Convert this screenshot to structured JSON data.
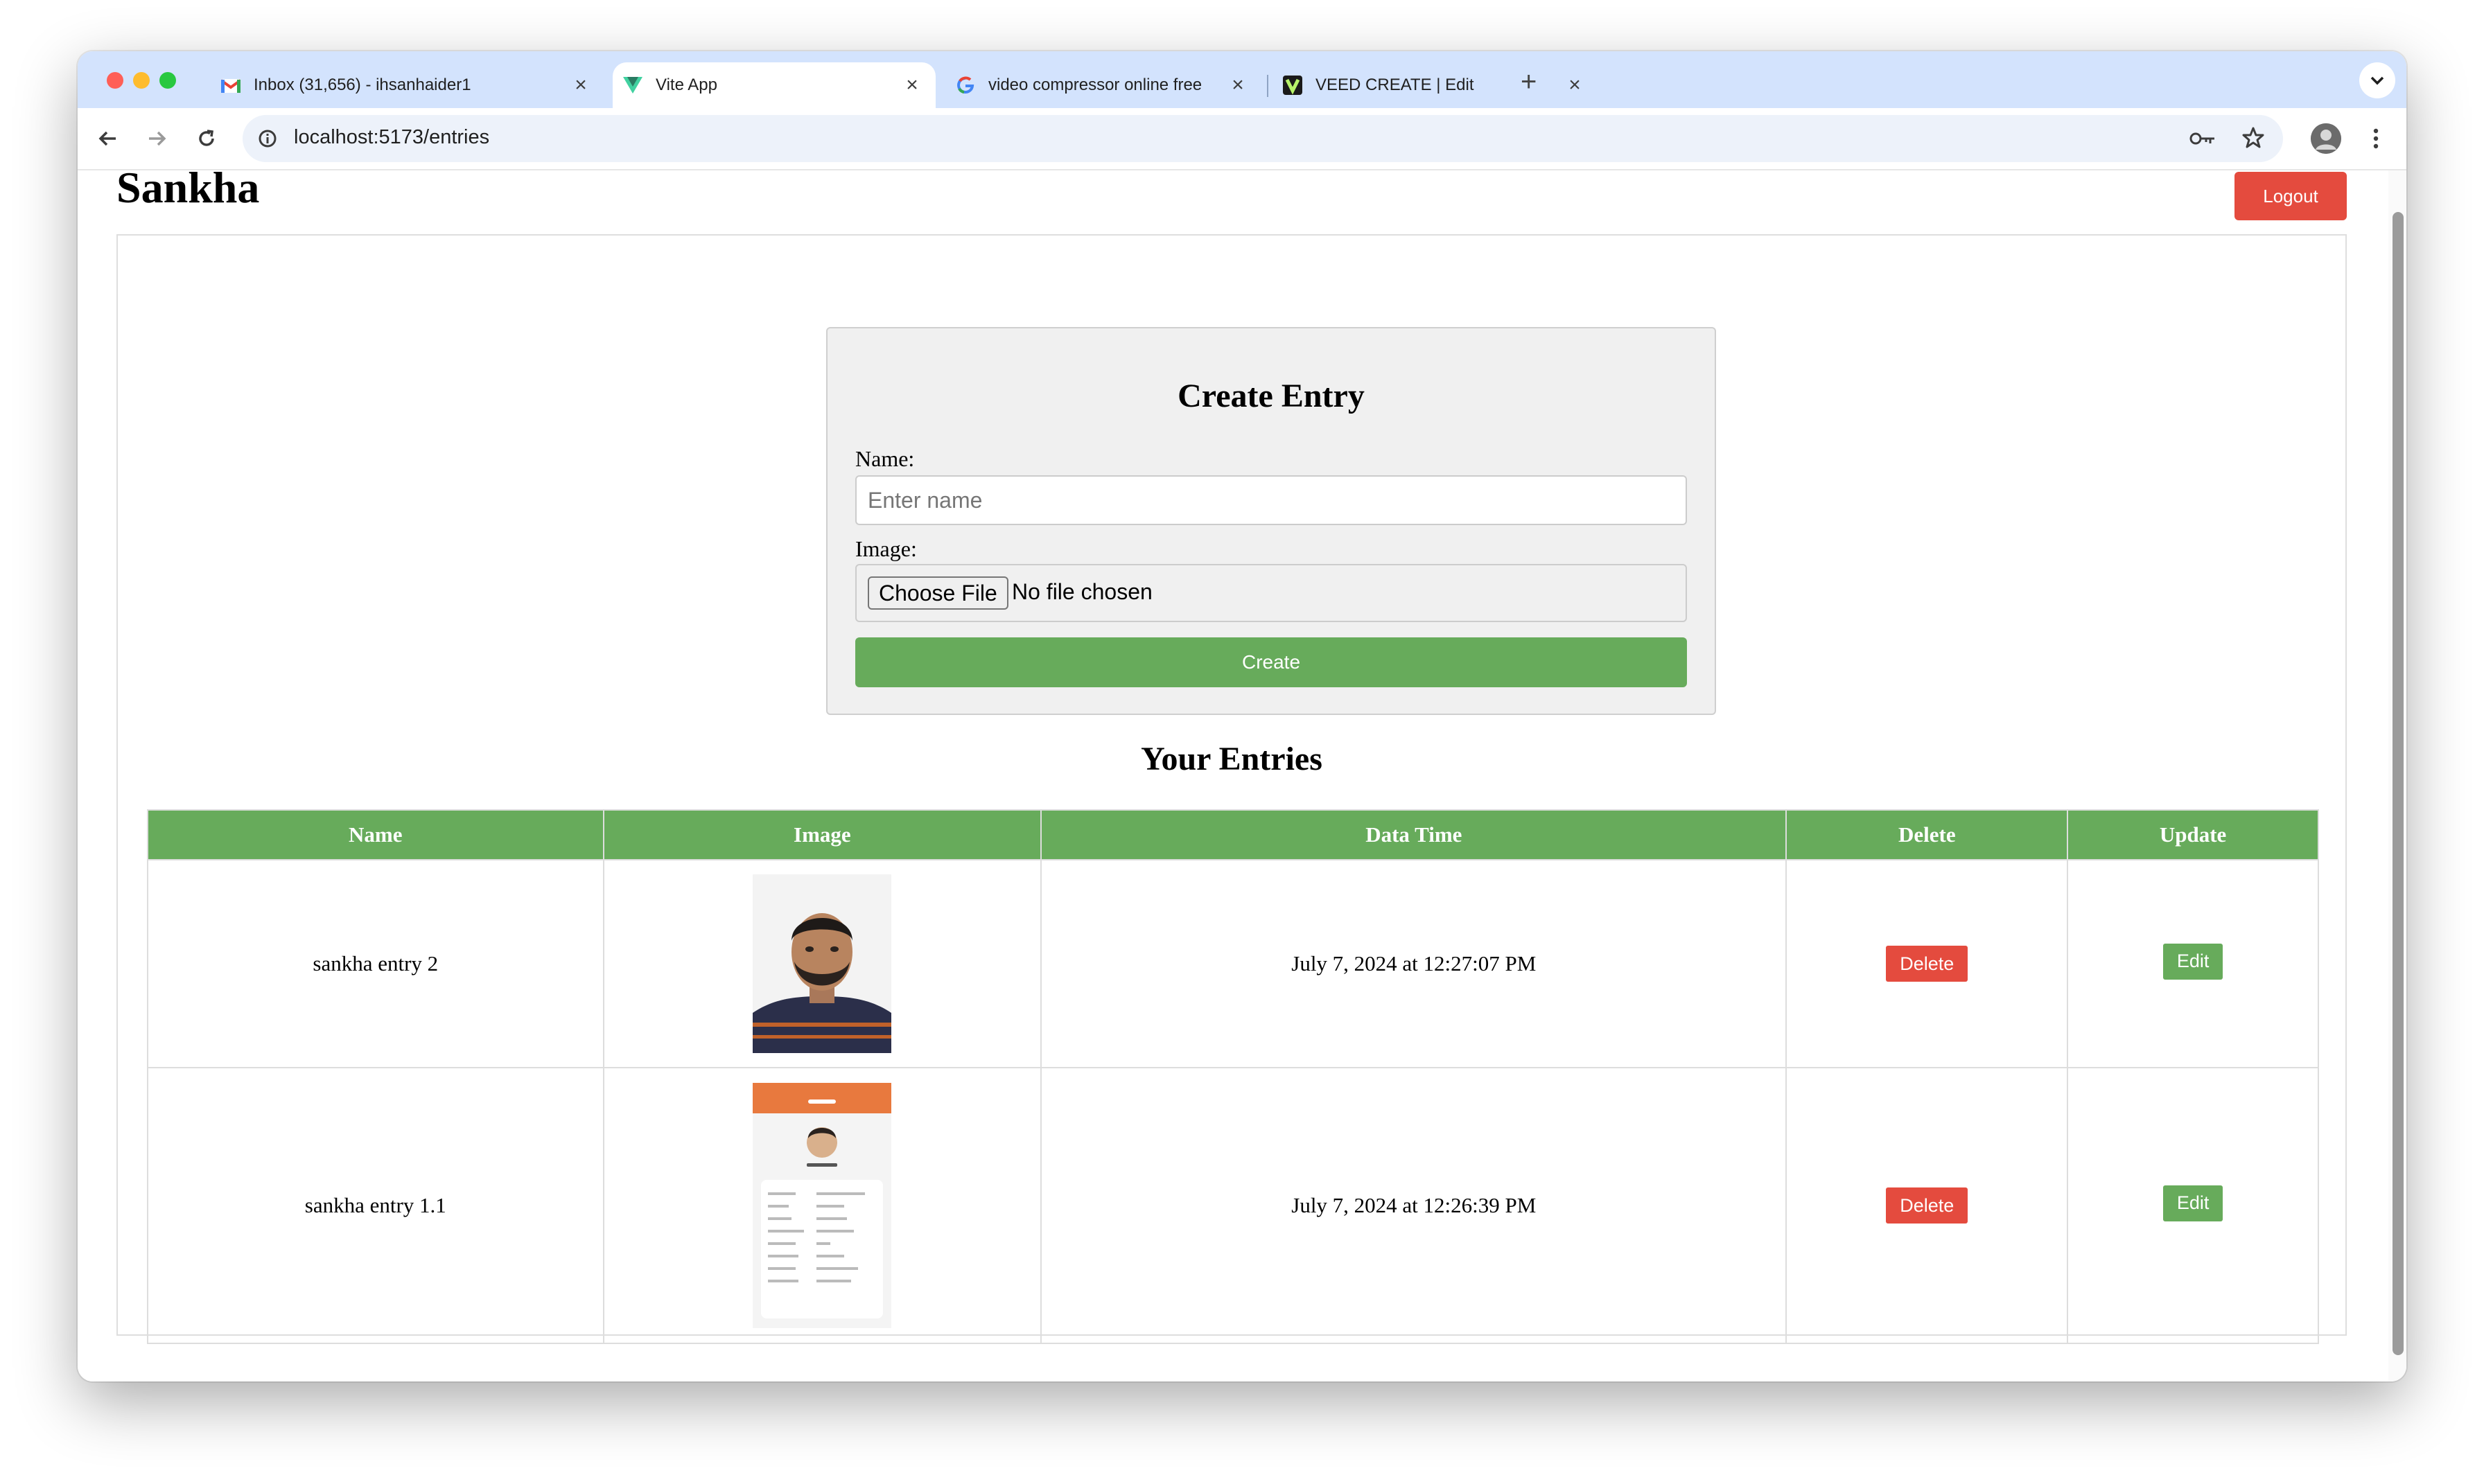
{
  "browser": {
    "tabs": [
      {
        "title": "Inbox (31,656) - ihsanhaider1",
        "favicon": "gmail-icon",
        "active": false
      },
      {
        "title": "Vite App",
        "favicon": "vite-icon",
        "active": true
      },
      {
        "title": "video compressor online free",
        "favicon": "google-icon",
        "active": false
      },
      {
        "title": "VEED CREATE | Edit",
        "favicon": "veed-icon",
        "active": false
      }
    ],
    "url": "localhost:5173/entries"
  },
  "header": {
    "title": "Sankha",
    "logout_label": "Logout"
  },
  "create_form": {
    "title": "Create Entry",
    "name_label": "Name:",
    "name_placeholder": "Enter name",
    "image_label": "Image:",
    "file_button": "Choose File",
    "file_status": "No file chosen",
    "submit_label": "Create"
  },
  "entries": {
    "title": "Your Entries",
    "columns": [
      "Name",
      "Image",
      "Data Time",
      "Delete",
      "Update"
    ],
    "rows": [
      {
        "name": "sankha entry 2",
        "image": "portrait-photo",
        "datetime": "July 7, 2024 at 12:27:07 PM",
        "delete_label": "Delete",
        "edit_label": "Edit"
      },
      {
        "name": "sankha entry 1.1",
        "image": "profile-screenshot",
        "datetime": "July 7, 2024 at 12:26:39 PM",
        "delete_label": "Delete",
        "edit_label": "Edit"
      }
    ]
  },
  "colors": {
    "accent_green": "#67ab5b",
    "danger_red": "#e44b3e",
    "tabstrip": "#d3e3fd"
  }
}
